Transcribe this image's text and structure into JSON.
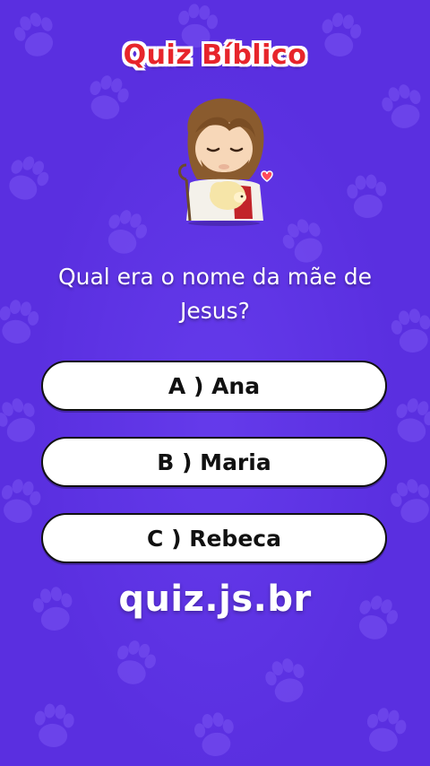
{
  "header": {
    "title": "Quiz Bíblico"
  },
  "question": {
    "text": "Qual era o nome da mãe de Jesus?"
  },
  "answers": [
    {
      "label": "A ) Ana"
    },
    {
      "label": "B ) Maria"
    },
    {
      "label": "C ) Rebeca"
    }
  ],
  "watermark": {
    "text": "quiz.js.br"
  },
  "theme": {
    "background": "#5a2fe0",
    "title_color": "#e7252b",
    "button_background": "#ffffff",
    "text_color": "#ffffff"
  },
  "icons": [
    "paw-icon",
    "jesus-mascot-illustration"
  ]
}
